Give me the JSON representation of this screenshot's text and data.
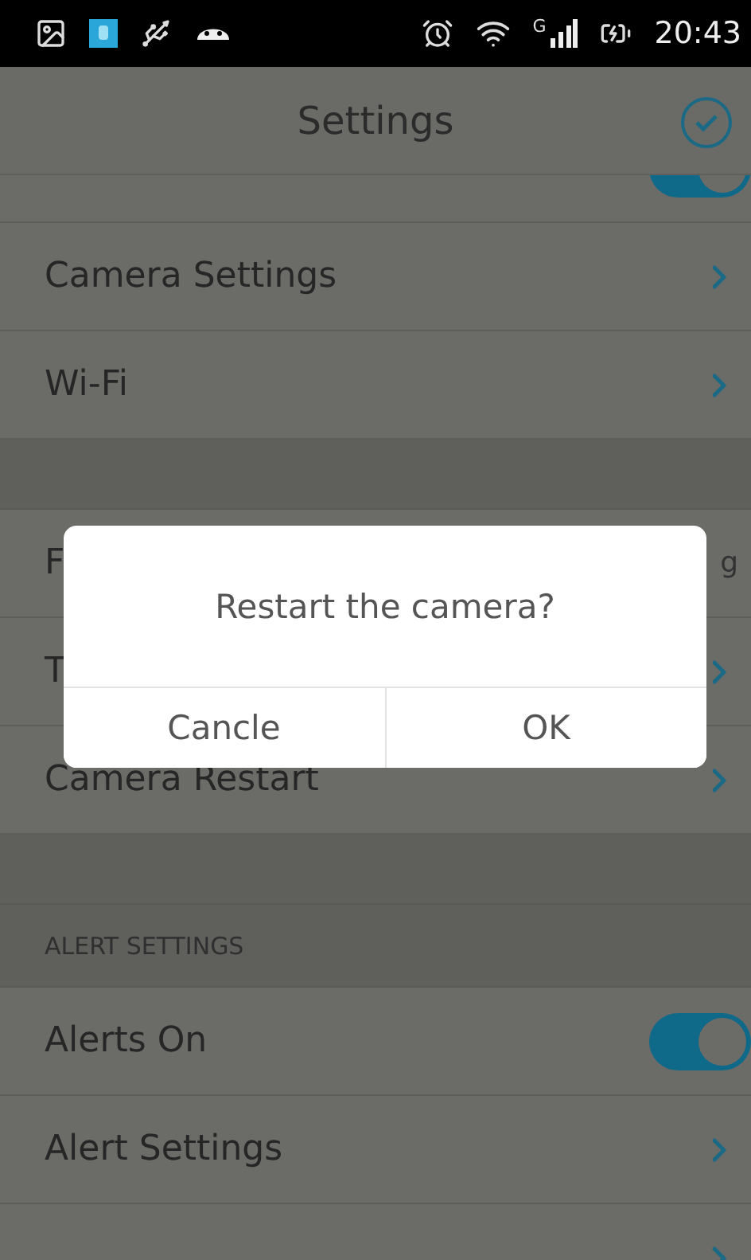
{
  "status_bar": {
    "network_type": "G",
    "time": "20:43"
  },
  "header": {
    "title": "Settings"
  },
  "list": [
    {
      "kind": "toggle",
      "on": true
    },
    {
      "kind": "link",
      "label": "Camera Settings"
    },
    {
      "kind": "link",
      "label": "Wi-Fi"
    },
    {
      "kind": "gap"
    },
    {
      "kind": "value",
      "label": "F",
      "value": "g"
    },
    {
      "kind": "link",
      "label": "T"
    },
    {
      "kind": "link",
      "label": "Camera Restart"
    },
    {
      "kind": "gap"
    },
    {
      "kind": "header",
      "label": "ALERT SETTINGS"
    },
    {
      "kind": "toggle",
      "label": "Alerts On",
      "on": true
    },
    {
      "kind": "link",
      "label": "Alert Settings"
    },
    {
      "kind": "link"
    }
  ],
  "dialog": {
    "message": "Restart the camera?",
    "buttons": [
      "Cancle",
      "OK"
    ]
  }
}
